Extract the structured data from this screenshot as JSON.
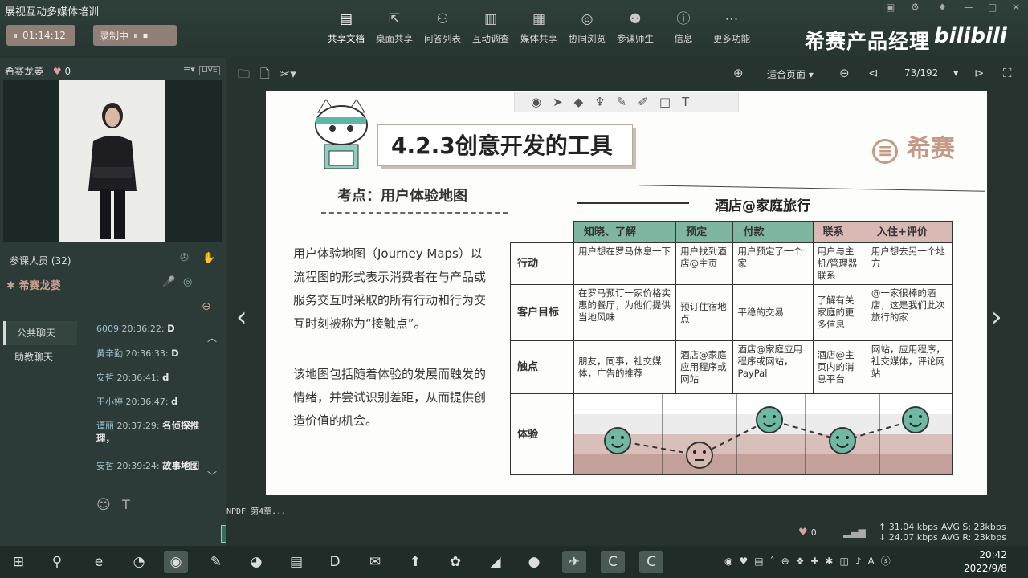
{
  "app": {
    "title": "展视互动多媒体培训",
    "timer": "01:14:12",
    "recording": "录制中"
  },
  "toolbar": {
    "items": [
      {
        "label": "共享文档",
        "icon": "document-icon"
      },
      {
        "label": "桌面共享",
        "icon": "desktop-share-icon"
      },
      {
        "label": "问答列表",
        "icon": "qa-icon"
      },
      {
        "label": "互动调查",
        "icon": "bar-chart-icon"
      },
      {
        "label": "媒体共享",
        "icon": "film-icon"
      },
      {
        "label": "协同浏览",
        "icon": "compass-icon"
      },
      {
        "label": "参课师生",
        "icon": "users-icon"
      },
      {
        "label": "信息",
        "icon": "info-icon"
      },
      {
        "label": "更多功能",
        "icon": "more-icon"
      }
    ]
  },
  "brand": {
    "text": "希赛产品经理",
    "bili": "bilibili"
  },
  "presenter": {
    "name": "希赛龙萎",
    "likes": "0",
    "badge": "LIVE"
  },
  "participants": {
    "label": "参课人员 (32)",
    "me": "希赛龙萎"
  },
  "chat": {
    "tabs": [
      "公共聊天",
      "助教聊天"
    ],
    "messages": [
      {
        "name": "6009",
        "time": "20:36:22:",
        "text": "D"
      },
      {
        "name": "黄辛勤",
        "time": "20:36:33:",
        "text": "D"
      },
      {
        "name": "安哲",
        "time": "20:36:41:",
        "text": "d"
      },
      {
        "name": "王小婷",
        "time": "20:36:47:",
        "text": "d"
      },
      {
        "name": "谭丽",
        "time": "20:37:29:",
        "text": "名侦探推理，"
      },
      {
        "name": "安哲",
        "time": "20:39:24:",
        "text": "故事地图"
      }
    ],
    "button": "聊天"
  },
  "doc": {
    "fit": "适合页面",
    "page": "73/192",
    "footer": "NPDF 第4章..."
  },
  "slide": {
    "title": "4.2.3创意开发的工具",
    "logo": "希赛",
    "kaodian": "考点：用户体验地图",
    "hotel": "酒店@家庭旅行",
    "desc1": "用户体验地图（Journey Maps）以流程图的形式表示消费者在与产品或服务交互时采取的所有行动和行为交互时刻被称为“接触点”。",
    "desc2": "该地图包括随着体验的发展而触发的情绪，并尝试识别差距，从而提供创造价值的机会。",
    "table": {
      "headers": [
        "知晓、了解",
        "预定",
        "付款",
        "联系",
        "入住+评价"
      ],
      "rows": [
        {
          "label": "行动",
          "cells": [
            "用户想在罗马休息一下",
            "用户找到酒店@主页",
            "用户预定了一个家",
            "用户与主机/管理器联系",
            "用户想去另一个地方"
          ]
        },
        {
          "label": "客户目标",
          "cells": [
            "在罗马预订一家价格实惠的餐厅，为他们提供当地风味",
            "预订住宿地点",
            "平稳的交易",
            "了解有关家庭的更多信息",
            "@一家很棒的酒店，这是我们此次旅行的家"
          ]
        },
        {
          "label": "触点",
          "cells": [
            "朋友，同事，社交媒体，广告的推荐",
            "酒店@家庭应用程序或网站",
            "酒店@家庭应用程序或网站，PayPal",
            "酒店@主页内的消息平台",
            "网站，应用程序，社交媒体，评论网站"
          ]
        },
        {
          "label": "体验",
          "cells": [
            "",
            "",
            "",
            "",
            ""
          ]
        }
      ],
      "emotions": [
        2,
        1,
        4,
        2,
        4
      ]
    }
  },
  "stats": {
    "up": "31.04 kbps",
    "down": "24.07 kbps",
    "avgs": "AVG S:  23kbps",
    "avgr": "AVG R:  23kbps",
    "likes": "0"
  },
  "clock": {
    "time": "20:42",
    "date": "2022/9/8"
  }
}
